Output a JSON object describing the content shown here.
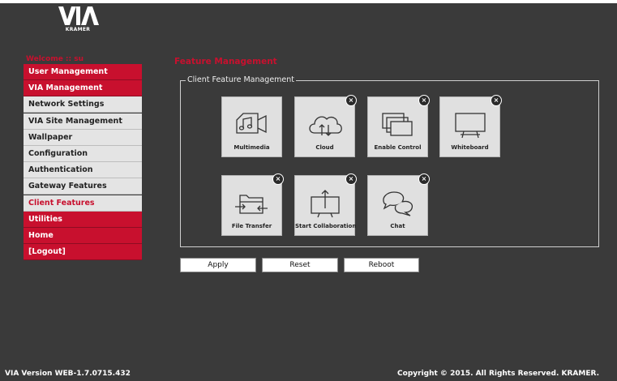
{
  "brand": {
    "logo_text": "VIA",
    "maker": "KRAMER"
  },
  "welcome": "Welcome :: su",
  "sidebar": {
    "items": [
      {
        "label": "User Management"
      },
      {
        "label": "VIA Management"
      },
      {
        "label": "Network Settings"
      },
      {
        "label": "VIA Site Management"
      },
      {
        "label": "Wallpaper"
      },
      {
        "label": "Configuration"
      },
      {
        "label": "Authentication"
      },
      {
        "label": "Gateway Features"
      },
      {
        "label": "Client Features"
      },
      {
        "label": "Utilities"
      },
      {
        "label": "Home"
      },
      {
        "label": "[Logout]"
      }
    ]
  },
  "main": {
    "heading": "Feature Management",
    "group_title": "Client Feature Management",
    "features": [
      {
        "label": "Multimedia",
        "icon": "music-video-icon"
      },
      {
        "label": "Cloud",
        "icon": "cloud-icon"
      },
      {
        "label": "Enable Control",
        "icon": "screens-icon"
      },
      {
        "label": "Whiteboard",
        "icon": "whiteboard-icon"
      },
      {
        "label": "File Transfer",
        "icon": "folder-transfer-icon"
      },
      {
        "label": "Start Collaboration",
        "icon": "collaboration-icon"
      },
      {
        "label": "Chat",
        "icon": "chat-icon"
      }
    ],
    "buttons": {
      "apply": "Apply",
      "reset": "Reset",
      "reboot": "Reboot"
    }
  },
  "footer": {
    "version": "VIA Version WEB-1.7.0715.432",
    "copyright": "Copyright © 2015. All Rights Reserved. KRAMER."
  },
  "colors": {
    "accent": "#c8102e",
    "background": "#3a3a3a",
    "tile": "#e0e0e0",
    "nav_grey": "#e4e4e4"
  }
}
